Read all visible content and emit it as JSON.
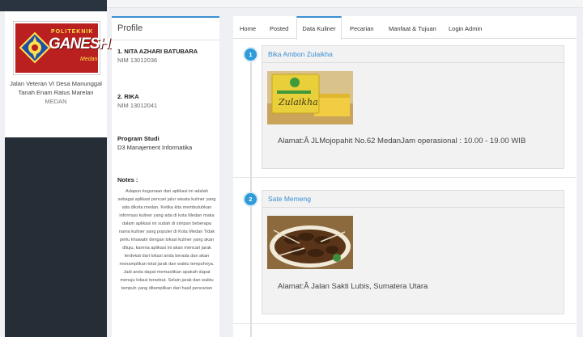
{
  "sidebar": {
    "logo": {
      "top_text": "POLITEKNIK",
      "name": "GANESHA",
      "city_script": "Medan"
    },
    "address_line1": "Jalan Veteran VI Desa Manunggal",
    "address_line2": "Tanah Enam Ratus Marelan",
    "address_city": "MEDAN"
  },
  "profile": {
    "title": "Profile",
    "members": [
      {
        "name": "1. NITA AZHARI BATUBARA",
        "nim": "NIM 13012036"
      },
      {
        "name": "2. RIKA",
        "nim": "NIM 13012041"
      }
    ],
    "program_label": "Program Studi",
    "program_value": "D3 Manajement Informatika",
    "notes_label": "Notes :",
    "notes_text": "Adapun kegunaan dari aplikasi ini adalah sebagai aplikasi pencari jalur wisata kuliner yang ada dikota medan. Ketika kita membutuhkan informasi kuliner yang ada di kota Medan maka dalam aplikasi ini sudah di simpan beberapa nama kuliner yang populer di Kota Medan Tidak perlu khawatir dengan lokasi kuliner yang akan dituju, karena aplikasi ini akan mencari jarak terdekat dari lokasi anda berada dan akan menampilkan total jarak dan waktu tempuhnya. Jadi anda dapat memastikan apakah dapat menuju lokasi tersebut. Selain jarak dan waktu tempuh yang ditampilkan dari hasil pencarian"
  },
  "nav": {
    "tabs": [
      "Home",
      "Posted",
      "Data Kuliner",
      "Pecarian",
      "Manfaat & Tujuan",
      "Login Admin"
    ],
    "active_index": 2
  },
  "entries": [
    {
      "number": "1",
      "title": "Bika Ambon Zulaikha",
      "image_icon": "bika-ambon-box-photo",
      "image_text": "Zulaikha",
      "address": "Alamat:Â JLMojopahit No.62 MedanJam operasional : 10.00 - 19.00 WIB"
    },
    {
      "number": "2",
      "title": "Sate Memeng",
      "image_icon": "satay-plate-photo",
      "address": "Alamat:Â Jalan Sakti Lubis, Sumatera Utara"
    }
  ],
  "colors": {
    "accent": "#3b8fd3",
    "badge": "#2f9bd8",
    "logo_red": "#b9201f",
    "sidebar_dark": "#252e37"
  }
}
